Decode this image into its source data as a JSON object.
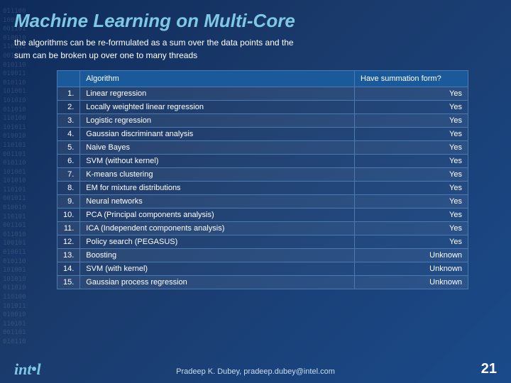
{
  "title": "Machine Learning  on Multi-Core",
  "subtitle_line1": "the algorithms can be re-formulated as a sum over the data points and the",
  "subtitle_line2": "sum can be broken up over one to many threads",
  "table": {
    "col1": "Algorithm",
    "col2": "Have summation form?",
    "rows": [
      {
        "num": "1.",
        "algo": "Linear regression",
        "answer": "Yes"
      },
      {
        "num": "2.",
        "algo": "Locally weighted linear regression",
        "answer": "Yes"
      },
      {
        "num": "3.",
        "algo": "Logistic regression",
        "answer": "Yes"
      },
      {
        "num": "4.",
        "algo": "Gaussian discriminant analysis",
        "answer": "Yes"
      },
      {
        "num": "5.",
        "algo": "Naive Bayes",
        "answer": "Yes"
      },
      {
        "num": "6.",
        "algo": "SVM (without kernel)",
        "answer": "Yes"
      },
      {
        "num": "7.",
        "algo": "K-means clustering",
        "answer": "Yes"
      },
      {
        "num": "8.",
        "algo": "EM for mixture distributions",
        "answer": "Yes"
      },
      {
        "num": "9.",
        "algo": "Neural networks",
        "answer": "Yes"
      },
      {
        "num": "10.",
        "algo": "PCA (Principal components analysis)",
        "answer": "Yes"
      },
      {
        "num": "11.",
        "algo": "ICA (Independent components analysis)",
        "answer": "Yes"
      },
      {
        "num": "12.",
        "algo": "Policy search (PEGASUS)",
        "answer": "Yes"
      },
      {
        "num": "13.",
        "algo": "Boosting",
        "answer": "Unknown"
      },
      {
        "num": "14.",
        "algo": "SVM (with kernel)",
        "answer": "Unknown"
      },
      {
        "num": "15.",
        "algo": "Gaussian process regression",
        "answer": "Unknown"
      }
    ]
  },
  "footer": {
    "credit": "Pradeep K. Dubey, pradeep.dubey@intel.com",
    "page": "21"
  },
  "binary": "01110010011010001001010100110101001011010110010011010110101001101010011010110100101011010010110101001101010110101001"
}
